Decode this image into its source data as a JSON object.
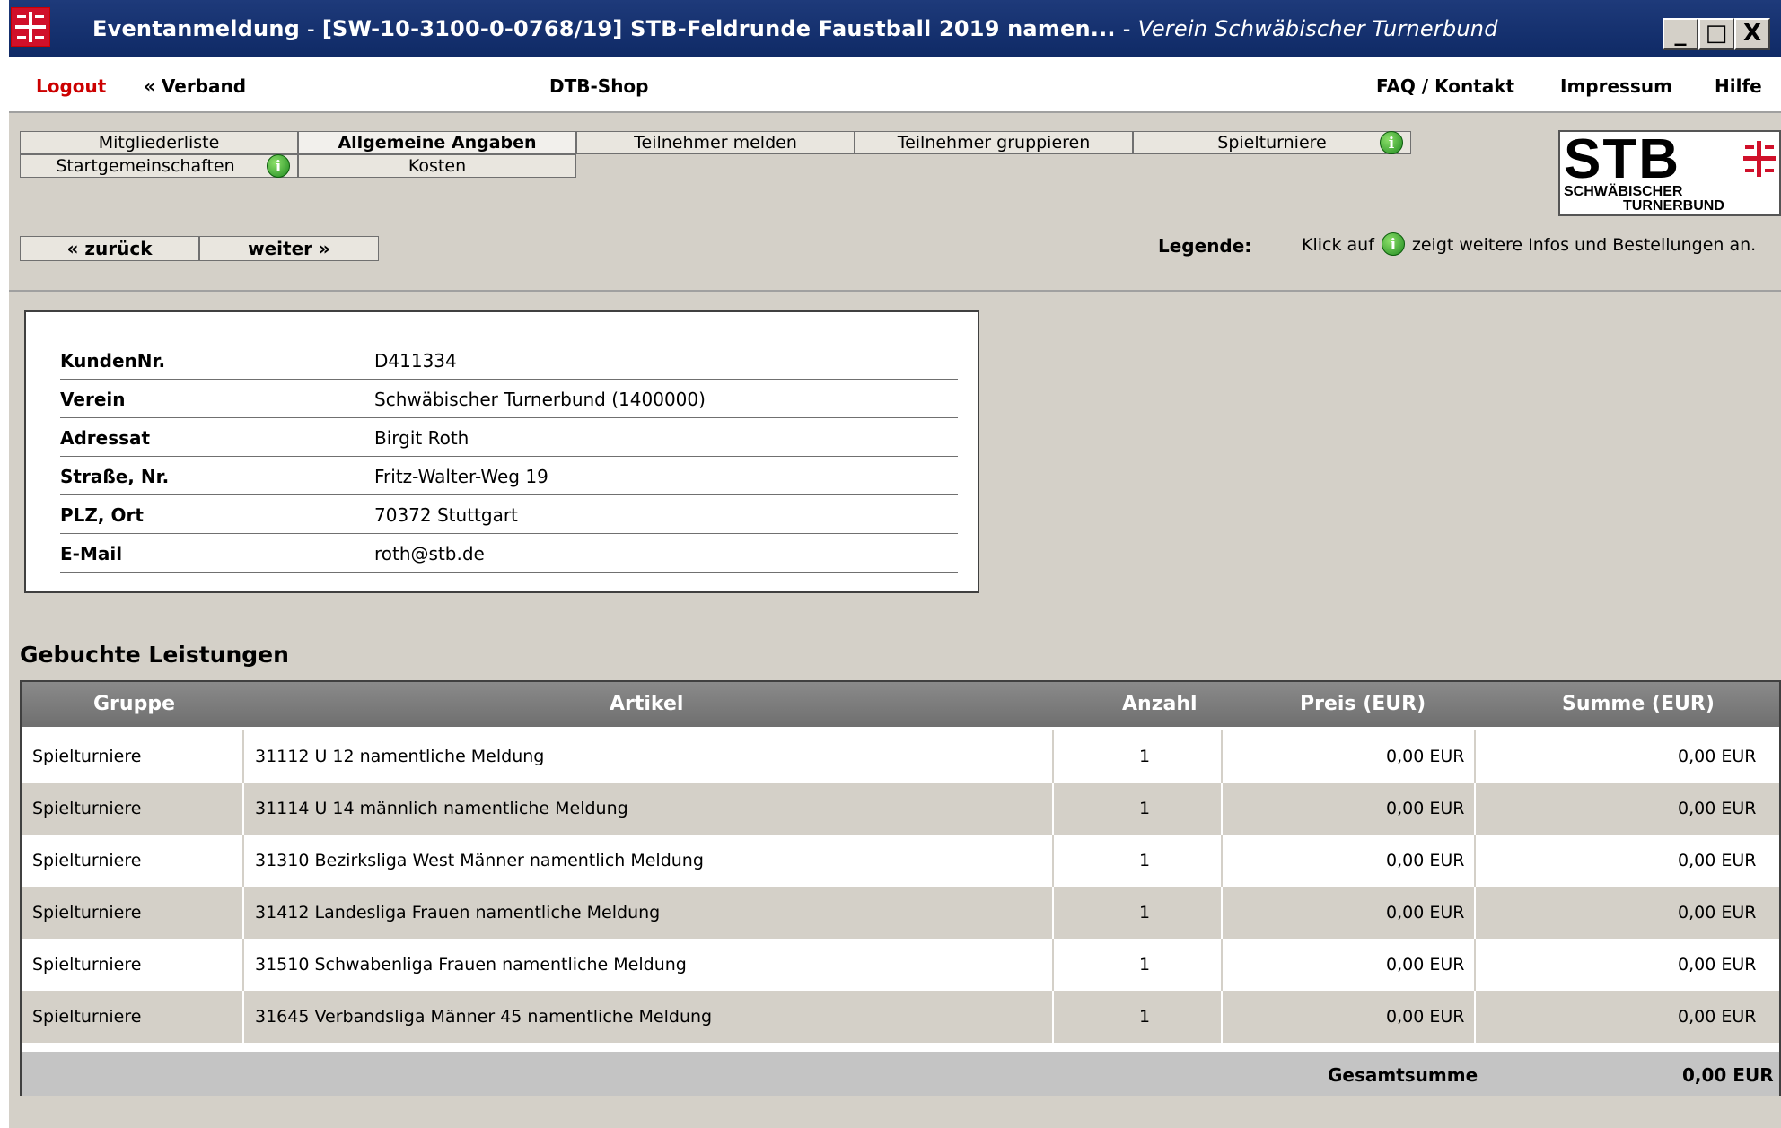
{
  "window": {
    "title_main": "Eventanmeldung",
    "title_sep": "-",
    "title_event": "[SW-10-3100-0-0768/19] STB-Feldrunde Faustball 2019 namen...",
    "title_sep2": "-",
    "title_sub": "Verein Schwäbischer Turnerbund",
    "minimize": "_",
    "maximize": "□",
    "close": "X"
  },
  "menu": {
    "logout": "Logout",
    "verband": "« Verband",
    "shop": "DTB-Shop",
    "faq": "FAQ / Kontakt",
    "impressum": "Impressum",
    "hilfe": "Hilfe"
  },
  "tabs": [
    {
      "label": "Mitgliederliste"
    },
    {
      "label": "Allgemeine Angaben"
    },
    {
      "label": "Teilnehmer melden"
    },
    {
      "label": "Teilnehmer gruppieren"
    },
    {
      "label": "Spielturniere"
    },
    {
      "label": "Startgemeinschaften"
    },
    {
      "label": "Kosten"
    }
  ],
  "nav": {
    "back": "« zurück",
    "next": "weiter »"
  },
  "legend": {
    "label": "Legende:",
    "text_before": "Klick auf",
    "text_after": "zeigt weitere Infos und Bestellungen an.",
    "info_glyph": "i"
  },
  "logo": {
    "main": "STB",
    "line1": "SCHWÄBISCHER",
    "line2": "TURNERBUND"
  },
  "customer": [
    {
      "label": "KundenNr.",
      "value": "D411334"
    },
    {
      "label": "Verein",
      "value": "Schwäbischer Turnerbund (1400000)"
    },
    {
      "label": "Adressat",
      "value": "Birgit Roth"
    },
    {
      "label": "Straße, Nr.",
      "value": "Fritz-Walter-Weg 19"
    },
    {
      "label": "PLZ, Ort",
      "value": "70372 Stuttgart"
    },
    {
      "label": "E-Mail",
      "value": "roth@stb.de"
    }
  ],
  "services": {
    "title": "Gebuchte Leistungen",
    "headers": {
      "gruppe": "Gruppe",
      "artikel": "Artikel",
      "anzahl": "Anzahl",
      "preis": "Preis (EUR)",
      "summe": "Summe (EUR)"
    },
    "rows": [
      {
        "gruppe": "Spielturniere",
        "artikel": "31112 U 12 namentliche Meldung",
        "anzahl": "1",
        "preis": "0,00 EUR",
        "summe": "0,00 EUR"
      },
      {
        "gruppe": "Spielturniere",
        "artikel": "31114 U 14 männlich namentliche Meldung",
        "anzahl": "1",
        "preis": "0,00 EUR",
        "summe": "0,00 EUR"
      },
      {
        "gruppe": "Spielturniere",
        "artikel": "31310 Bezirksliga West Männer namentlich Meldung",
        "anzahl": "1",
        "preis": "0,00 EUR",
        "summe": "0,00 EUR"
      },
      {
        "gruppe": "Spielturniere",
        "artikel": "31412 Landesliga Frauen namentliche Meldung",
        "anzahl": "1",
        "preis": "0,00 EUR",
        "summe": "0,00 EUR"
      },
      {
        "gruppe": "Spielturniere",
        "artikel": "31510 Schwabenliga Frauen namentliche Meldung",
        "anzahl": "1",
        "preis": "0,00 EUR",
        "summe": "0,00 EUR"
      },
      {
        "gruppe": "Spielturniere",
        "artikel": "31645 Verbandsliga Männer 45 namentliche Meldung",
        "anzahl": "1",
        "preis": "0,00 EUR",
        "summe": "0,00 EUR"
      }
    ],
    "total_label": "Gesamtsumme",
    "total_value": "0,00 EUR"
  },
  "colors": {
    "titlebar": "#0f2a66",
    "logout": "#cc0000",
    "panel": "#d4d0c8",
    "info_green": "#1f8a1f",
    "brand_red": "#d0102a"
  },
  "icons": {
    "title_logo": "stb-cross-logo-icon",
    "info": "info-icon"
  }
}
